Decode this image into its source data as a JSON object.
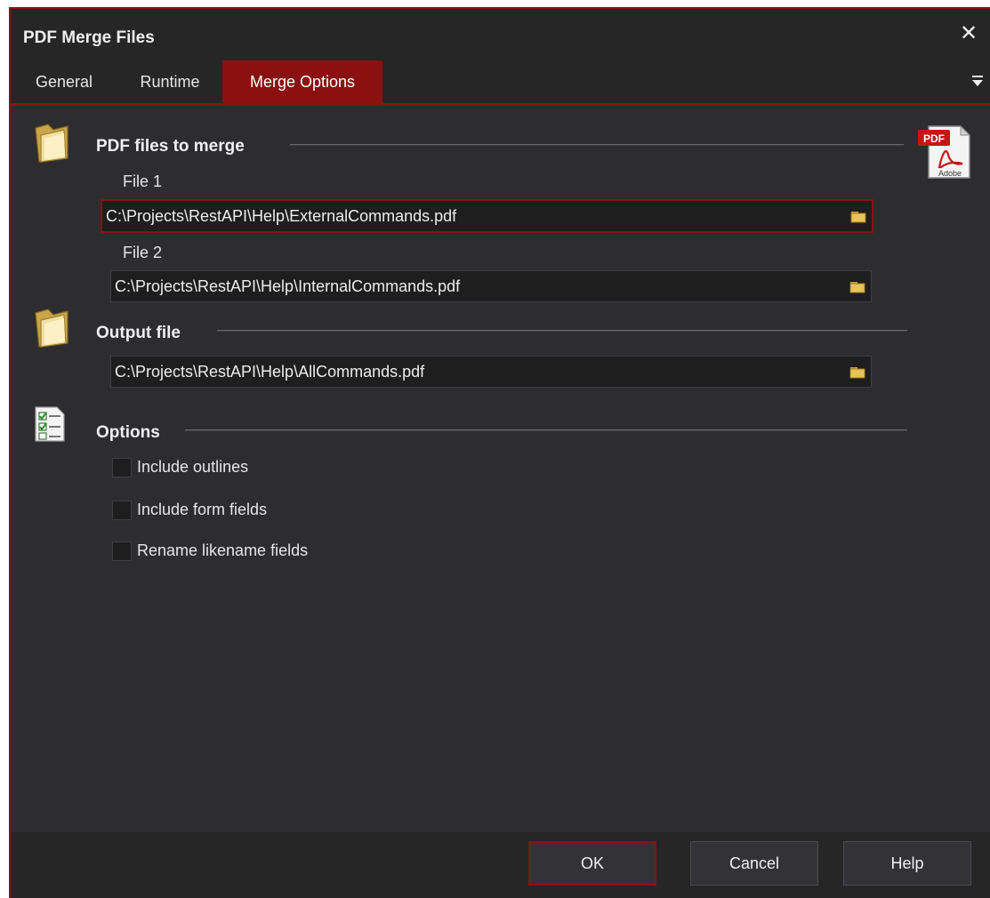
{
  "window": {
    "title": "PDF Merge Files"
  },
  "tabs": [
    {
      "label": "General"
    },
    {
      "label": "Runtime"
    },
    {
      "label": "Merge Options",
      "active": true
    }
  ],
  "sections": {
    "pdf_files": {
      "title": "PDF files to merge",
      "file1": {
        "label": "File 1",
        "value": "C:\\Projects\\RestAPI\\Help\\ExternalCommands.pdf"
      },
      "file2": {
        "label": "File 2",
        "value": "C:\\Projects\\RestAPI\\Help\\InternalCommands.pdf"
      }
    },
    "output": {
      "title": "Output file",
      "value": "C:\\Projects\\RestAPI\\Help\\AllCommands.pdf"
    },
    "options": {
      "title": "Options",
      "items": [
        {
          "label": "Include outlines",
          "checked": false
        },
        {
          "label": "Include form fields",
          "checked": false
        },
        {
          "label": "Rename likename fields",
          "checked": false
        }
      ]
    }
  },
  "pdf_badge": {
    "top_text": "PDF",
    "bottom_text": "Adobe"
  },
  "buttons": {
    "ok": "OK",
    "cancel": "Cancel",
    "help": "Help"
  },
  "icons": {
    "close": "close-icon",
    "tab_menu": "dropdown-menu-icon",
    "folder": "folder-icon",
    "browse": "browse-folder-icon",
    "pdf": "pdf-document-icon",
    "checklist": "checklist-icon"
  },
  "colors": {
    "accent": "#8b1111",
    "background": "#2d2d30",
    "field_background": "#1e1e1e"
  }
}
